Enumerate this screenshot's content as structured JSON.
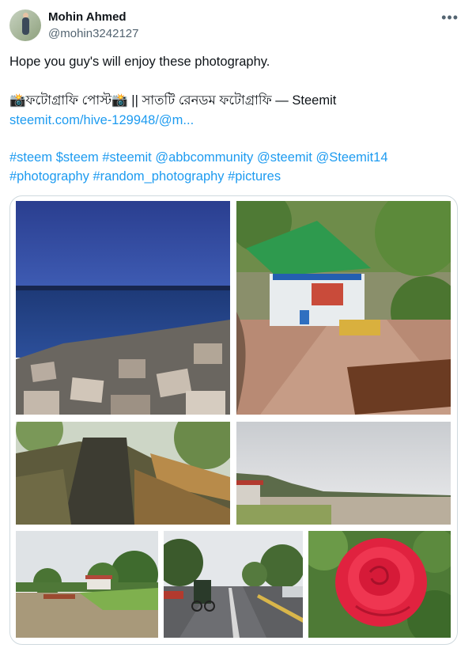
{
  "author": {
    "name": "Mohin Ahmed",
    "handle": "@mohin3242127"
  },
  "more_icon": "more-horizontal-icon",
  "body": {
    "line1": "Hope you guy's will enjoy these photography.",
    "line2": "📸ফটোগ্রাফি পোস্ট📸 || সাতটি রেনডম ফটোগ্রাফি — Steemit",
    "link": "steemit.com/hive-129948/@m...",
    "hashtags_line1": "#steem $steem #steemit @abbcommunity @steemit @Steemit14",
    "hashtags_line2": "#photography #random_photography #pictures"
  },
  "media": {
    "count": 7,
    "photos": [
      {
        "subject": "river at dusk with concrete blocks"
      },
      {
        "subject": "green-roofed shop by brick path"
      },
      {
        "subject": "stone steps with wooden railing"
      },
      {
        "subject": "cloudy river landscape"
      },
      {
        "subject": "river bank with trees"
      },
      {
        "subject": "rainy road with rickshaw"
      },
      {
        "subject": "red rose"
      }
    ]
  }
}
